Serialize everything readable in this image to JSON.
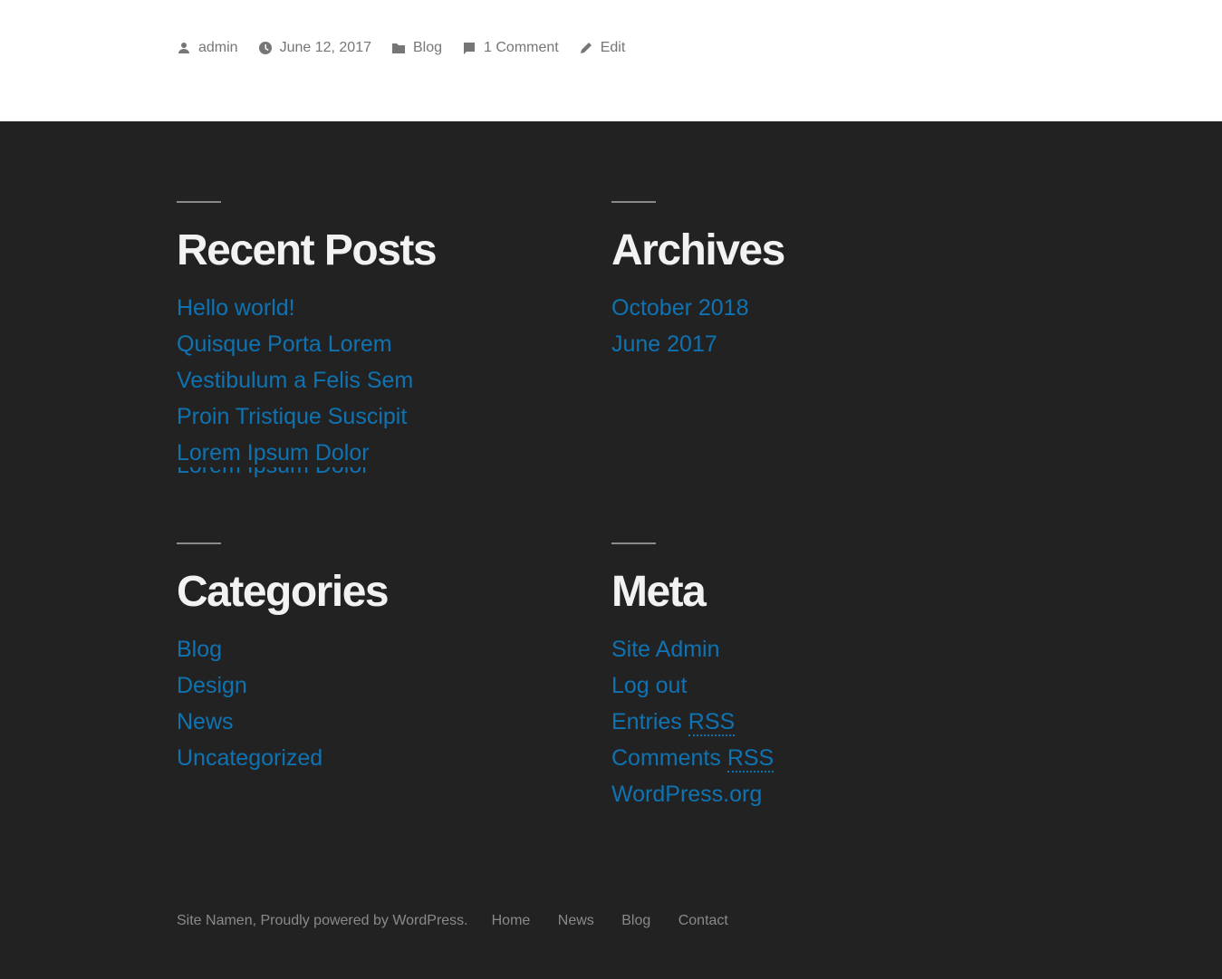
{
  "post_meta": {
    "author": "admin",
    "date": "June 12, 2017",
    "category": "Blog",
    "comments": "1 Comment",
    "edit": "Edit"
  },
  "widgets": {
    "recent_posts": {
      "title": "Recent Posts",
      "items": [
        "Hello world!",
        "Quisque Porta Lorem",
        "Vestibulum a Felis Sem",
        "Proin Tristique Suscipit",
        "Lorem Ipsum Dolor"
      ],
      "clipped_item": "Lorem Ipsum Dolor"
    },
    "archives": {
      "title": "Archives",
      "items": [
        "October 2018",
        "June 2017"
      ]
    },
    "categories": {
      "title": "Categories",
      "items": [
        "Blog",
        "Design",
        "News",
        "Uncategorized"
      ]
    },
    "meta": {
      "title": "Meta",
      "items": [
        "Site Admin",
        "Log out",
        "Entries",
        "Comments",
        "WordPress.org"
      ],
      "rss_abbr": "RSS"
    }
  },
  "footer": {
    "credit": "Site Namen, Proudly powered by WordPress.",
    "nav": [
      "Home",
      "News",
      "Blog",
      "Contact"
    ]
  },
  "colors": {
    "link": "#0f73b2",
    "footer_bg": "#222222",
    "heading": "#f2f2f2",
    "muted": "#767676"
  },
  "icons": {
    "author": "person-icon",
    "date": "clock-icon",
    "category": "folder-icon",
    "comments": "comment-icon",
    "edit": "pencil-icon"
  }
}
